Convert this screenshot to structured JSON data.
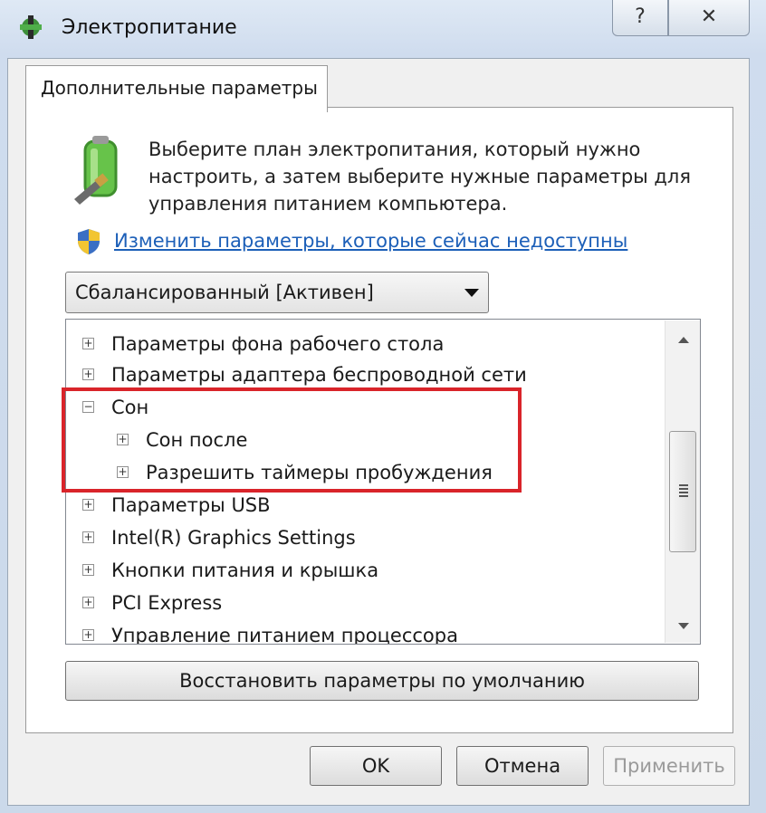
{
  "window": {
    "title": "Электропитание",
    "help_glyph": "?",
    "close_glyph": "✕"
  },
  "tab": {
    "label": "Дополнительные параметры"
  },
  "description": "Выберите план электропитания, который нужно настроить, а затем выберите нужные параметры для управления питанием компьютера.",
  "link": {
    "text": "Изменить параметры, которые сейчас недоступны"
  },
  "plan_select": {
    "value": "Сбалансированный [Активен]"
  },
  "tree": {
    "items": [
      {
        "label": "Параметры фона рабочего стола",
        "expander": "+",
        "level": 0
      },
      {
        "label": "Параметры адаптера беспроводной сети",
        "expander": "+",
        "level": 0
      },
      {
        "label": "Сон",
        "expander": "−",
        "level": 0
      },
      {
        "label": "Сон после",
        "expander": "+",
        "level": 1
      },
      {
        "label": "Разрешить таймеры пробуждения",
        "expander": "+",
        "level": 1
      },
      {
        "label": "Параметры USB",
        "expander": "+",
        "level": 0
      },
      {
        "label": "Intel(R) Graphics Settings",
        "expander": "+",
        "level": 0
      },
      {
        "label": "Кнопки питания и крышка",
        "expander": "+",
        "level": 0
      },
      {
        "label": "PCI Express",
        "expander": "+",
        "level": 0
      },
      {
        "label": "Управление питанием процессора",
        "expander": "+",
        "level": 0
      }
    ]
  },
  "buttons": {
    "restore": "Восстановить параметры по умолчанию",
    "ok": "OK",
    "cancel": "Отмена",
    "apply": "Применить"
  },
  "colors": {
    "highlight": "#d9242a",
    "link": "#1c5fb8"
  }
}
